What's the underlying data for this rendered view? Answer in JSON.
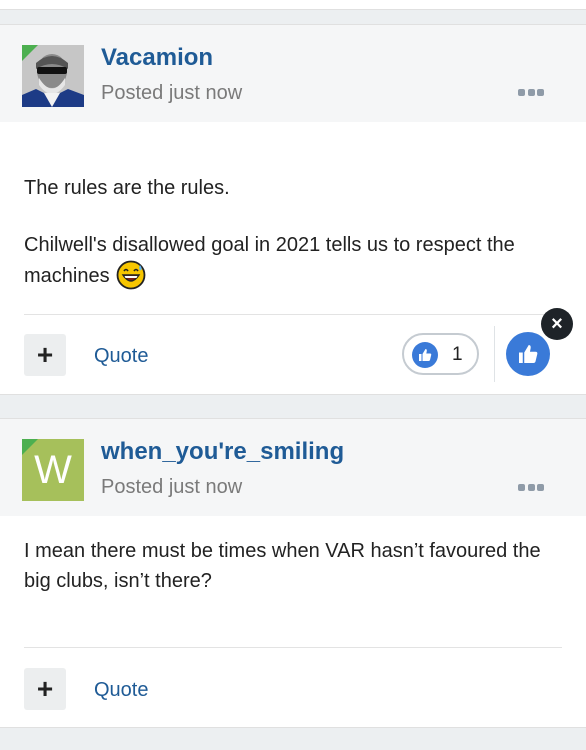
{
  "posts": [
    {
      "author": "Vacamion",
      "posted": "Posted just now",
      "paragraphs": [
        "The rules are the rules.",
        "Chilwell's disallowed goal in 2021 tells us to respect the machines"
      ],
      "emoji": "grinning-sweat-emoji",
      "quote_label": "Quote",
      "plus_label": "+",
      "reaction_count": "1"
    },
    {
      "author": "when_you're_smiling",
      "posted": "Posted just now",
      "avatar_letter": "W",
      "paragraphs": [
        "I mean there must be times when VAR hasn’t favoured the big clubs, isn’t there?"
      ],
      "quote_label": "Quote",
      "plus_label": "+"
    }
  ],
  "close_label": "×",
  "colors": {
    "author": "#1f5b96",
    "accent_blue": "#3a7ad8",
    "badge_green": "#4caf50",
    "avatar_w_bg": "#a6c05b"
  }
}
